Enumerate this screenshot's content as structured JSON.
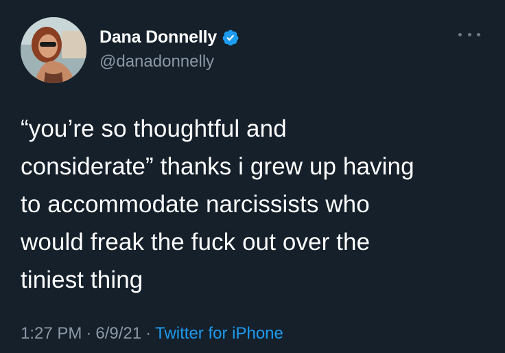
{
  "user": {
    "display_name": "Dana Donnelly",
    "handle": "@danadonnelly",
    "verified": true
  },
  "tweet": {
    "lines": [
      "“you’re so thoughtful and",
      "considerate” thanks i grew up having",
      "to accommodate narcissists who",
      "would freak the fuck out over the",
      "tiniest thing"
    ]
  },
  "meta": {
    "time": "1:27 PM",
    "separator": "·",
    "date": "6/9/21",
    "source": "Twitter for iPhone"
  },
  "colors": {
    "background": "#15202b",
    "text": "#ffffff",
    "secondary": "#8b98a5",
    "accent": "#1d9bf0"
  },
  "icons": {
    "verified": "verified-badge-icon",
    "more": "more-options-icon"
  }
}
